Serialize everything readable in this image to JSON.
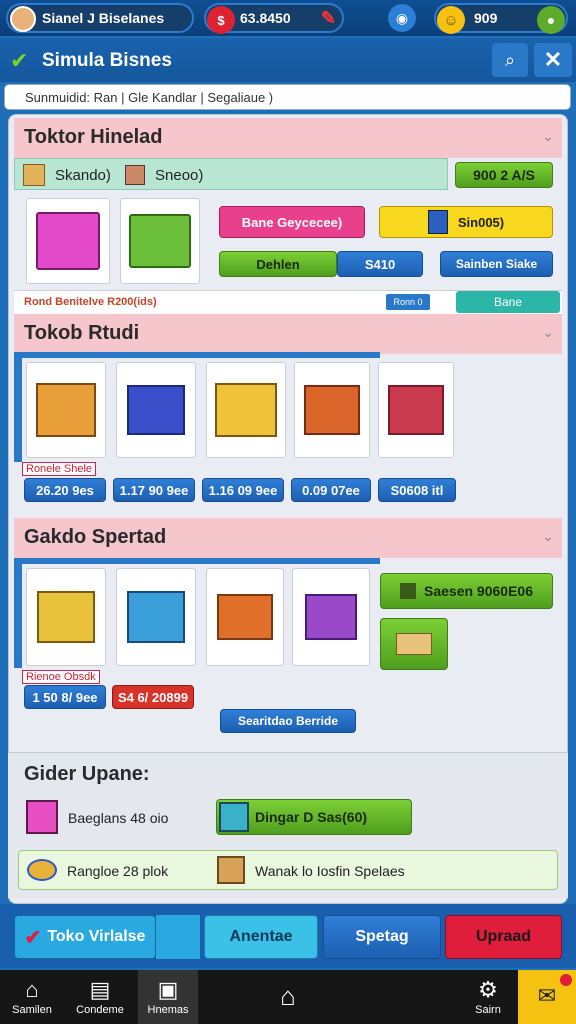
{
  "status": {
    "profile": "Sianel J Biselanes",
    "money": "63.8450",
    "coins": "909"
  },
  "header": {
    "title": "Simula Bisnes"
  },
  "search": {
    "placeholder": "Sunmuidid: Ran  |  Gle Kandlar  |  Segaliaue  )"
  },
  "section1": {
    "title": "Toktor Hinelad",
    "strip_label": "Skando)",
    "strip_label2": "Sneoo)",
    "strip_value": "900 2 A/S",
    "btn_pink": "Bane Geycecee)",
    "btn_yellow": "Sin005)",
    "btn_green": "Dehlen",
    "btn_blue": "S410",
    "btn_blue2": "Sainben Siake",
    "footer_text": "Rond Benitelve R200(ids)",
    "footer_badge": "Ronn 0",
    "footer_btn": "Bane"
  },
  "section2": {
    "title": "Tokob Rtudi",
    "tiny_label": "Ronele Shele",
    "prices": [
      "26.20 9es",
      "1.17 90 9ee",
      "1.16 09 9ee",
      "0.09 07ee",
      "S0608 itl"
    ]
  },
  "section3": {
    "title": "Gakdo Spertad",
    "side_btn": "Saesen 9060E06",
    "tiny_label": "Rienoe Obsdk",
    "prices": [
      "1 50 8/ 9ee",
      "S4 6/ 20899"
    ],
    "bottom_btn": "Searitdao Berride"
  },
  "upgrade": {
    "title": "Gider Upane:",
    "rows": [
      {
        "label": "Baeglans 48 oio"
      },
      {
        "label": "Dingar D  Sas(60)"
      },
      {
        "label": "Rangloe  28 plok"
      },
      {
        "label": "Wanak lo  Iosfin  Spelaes"
      }
    ]
  },
  "actions": {
    "toko": "Toko Virlalse",
    "anentas": "Anentae",
    "spetag": "Spetag",
    "upraad": "Upraad"
  },
  "nav": [
    {
      "label": "Samilen"
    },
    {
      "label": "Condeme"
    },
    {
      "label": "Hnemas"
    },
    {
      "label": ""
    },
    {
      "label": "Sairn"
    },
    {
      "label": ""
    }
  ],
  "colors": {
    "accent": "#1d5fb0",
    "pink": "#f5c6cb",
    "green": "#5fb42a",
    "red": "#e11d3c"
  }
}
